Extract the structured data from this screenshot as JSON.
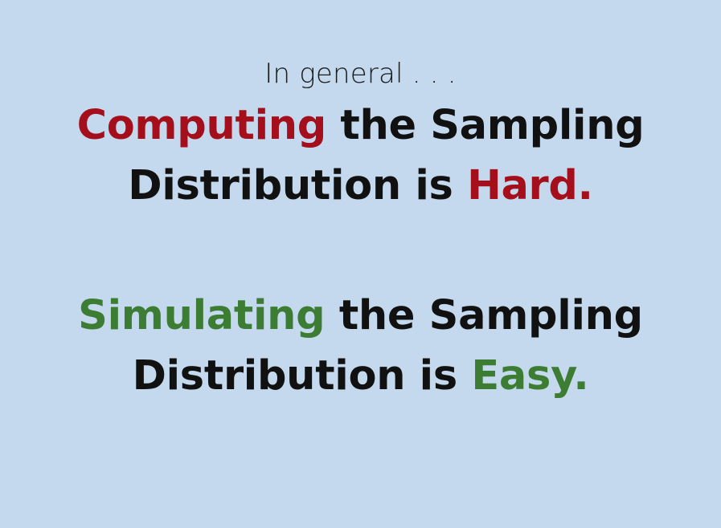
{
  "slide": {
    "intro": "In general . . .",
    "hard_block": {
      "line1": {
        "accent": "Computing",
        "rest": " the Sampling"
      },
      "line2": {
        "lead": "Distribution is ",
        "accent": "Hard."
      }
    },
    "easy_block": {
      "line1": {
        "accent": "Simulating",
        "rest": " the Sampling"
      },
      "line2": {
        "lead": "Distribution is ",
        "accent": "Easy."
      }
    }
  },
  "colors": {
    "background": "#c4d9ee",
    "text": "#111111",
    "hard_accent": "#a50e1b",
    "easy_accent": "#3c7d33"
  }
}
